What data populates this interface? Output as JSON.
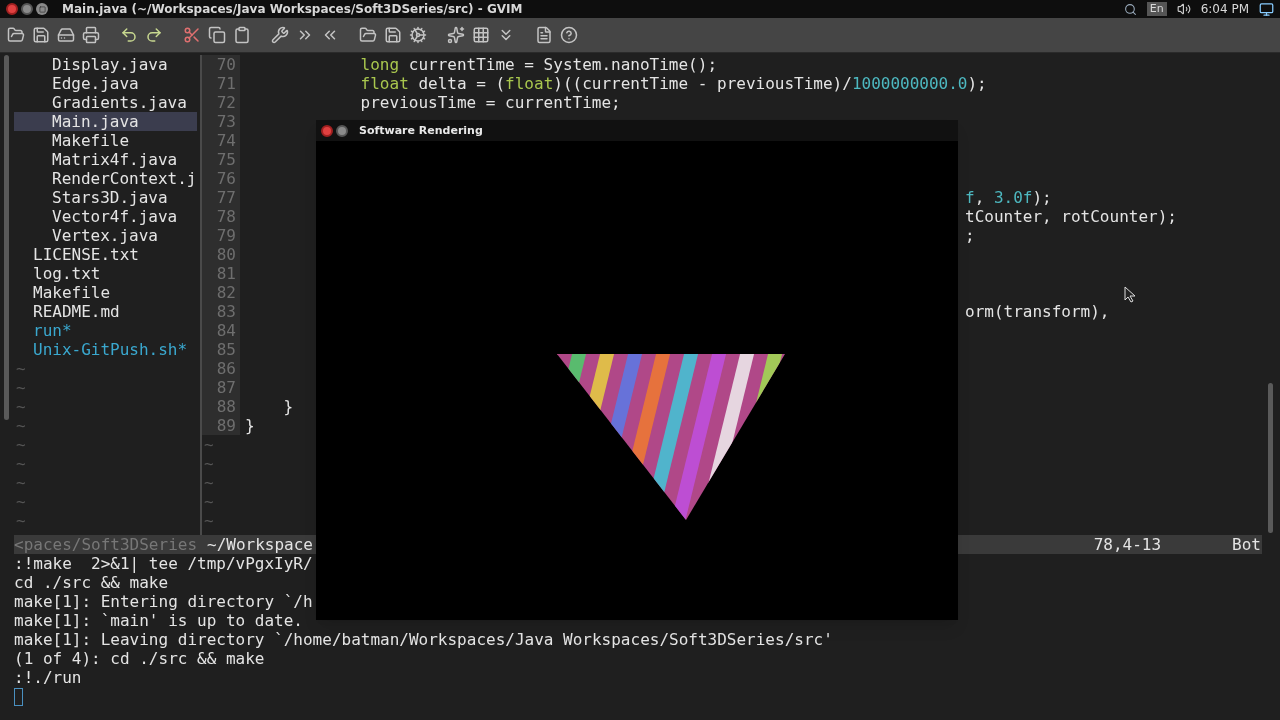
{
  "top_panel": {
    "window_title": "Main.java (~/Workspaces/Java Workspaces/Soft3DSeries/src) - GVIM",
    "keyboard_layout": "En",
    "clock": "6:04 PM"
  },
  "file_tree": {
    "items": [
      {
        "children": [
          {
            "label": "Display.java",
            "kind": "file",
            "selected": false
          },
          {
            "label": "Edge.java",
            "kind": "file",
            "selected": false
          },
          {
            "label": "Gradients.java",
            "kind": "file",
            "selected": false
          },
          {
            "label": "Main.java",
            "kind": "file",
            "selected": true
          },
          {
            "label": "Makefile",
            "kind": "file",
            "selected": false
          },
          {
            "label": "Matrix4f.java",
            "kind": "file",
            "selected": false
          },
          {
            "label": "RenderContext.j",
            "kind": "file",
            "selected": false
          },
          {
            "label": "Stars3D.java",
            "kind": "file",
            "selected": false
          },
          {
            "label": "Vector4f.java",
            "kind": "file",
            "selected": false
          },
          {
            "label": "Vertex.java",
            "kind": "file",
            "selected": false
          }
        ]
      },
      {
        "label": "LICENSE.txt",
        "kind": "file",
        "selected": false
      },
      {
        "label": "log.txt",
        "kind": "file",
        "selected": false
      },
      {
        "label": "Makefile",
        "kind": "file",
        "selected": false
      },
      {
        "label": "README.md",
        "kind": "file",
        "selected": false
      },
      {
        "label": "run*",
        "kind": "executable",
        "selected": false
      },
      {
        "label": "Unix-GitPush.sh*",
        "kind": "executable",
        "selected": false
      }
    ],
    "empty_markers": [
      "~",
      "~",
      "~",
      "~",
      "~",
      "~",
      "~",
      "~",
      "~"
    ]
  },
  "editor": {
    "lines": [
      {
        "number": "70",
        "left": [
          {
            "text": "            long",
            "kind": "keyword"
          },
          {
            "text": " currentTime = System.nanoTime();",
            "kind": "text"
          }
        ]
      },
      {
        "number": "71",
        "left": [
          {
            "text": "            float",
            "kind": "keyword"
          },
          {
            "text": " delta = (",
            "kind": "text"
          },
          {
            "text": "float",
            "kind": "keyword"
          },
          {
            "text": ")((currentTime - previousTime)/",
            "kind": "text"
          },
          {
            "text": "1000000000.0",
            "kind": "number"
          },
          {
            "text": ");",
            "kind": "text"
          }
        ]
      },
      {
        "number": "72",
        "left": [
          {
            "text": "            previousTime = currentTime;",
            "kind": "text"
          }
        ]
      },
      {
        "number": "73"
      },
      {
        "number": "74"
      },
      {
        "number": "75"
      },
      {
        "number": "76"
      },
      {
        "number": "77",
        "right": [
          {
            "text": "f",
            "kind": "number"
          },
          {
            "text": ", ",
            "kind": "text"
          },
          {
            "text": "3.0f",
            "kind": "number"
          },
          {
            "text": ");",
            "kind": "text"
          }
        ]
      },
      {
        "number": "78",
        "right": [
          {
            "text": "tCounter, rotCounter);",
            "kind": "text"
          }
        ]
      },
      {
        "number": "79",
        "right": [
          {
            "text": ";",
            "kind": "text"
          }
        ]
      },
      {
        "number": "80"
      },
      {
        "number": "81"
      },
      {
        "number": "82"
      },
      {
        "number": "83",
        "right": [
          {
            "text": "orm(transform),",
            "kind": "text"
          }
        ]
      },
      {
        "number": "84"
      },
      {
        "number": "85"
      },
      {
        "number": "86"
      },
      {
        "number": "87"
      },
      {
        "number": "88",
        "left": [
          {
            "text": "    }",
            "kind": "text"
          }
        ]
      },
      {
        "number": "89",
        "left": [
          {
            "text": "}",
            "kind": "text"
          }
        ]
      }
    ],
    "empty_markers": [
      "~",
      "~",
      "~",
      "~",
      "~"
    ]
  },
  "status_line": {
    "path_dim": "<paces/Soft3DSeries",
    "path": "~/Workspace",
    "position": "78,4-13",
    "scroll": "Bot"
  },
  "messages": [
    ":!make  2>&1| tee /tmp/vPgxIyR/",
    "cd ./src && make",
    "make[1]: Entering directory `/h",
    "make[1]: `main' is up to date.",
    "make[1]: Leaving directory `/home/batman/Workspaces/Java Workspaces/Soft3DSeries/src'",
    "(1 of 4): cd ./src && make",
    ":!./run"
  ],
  "render_window": {
    "title": "Software Rendering"
  }
}
